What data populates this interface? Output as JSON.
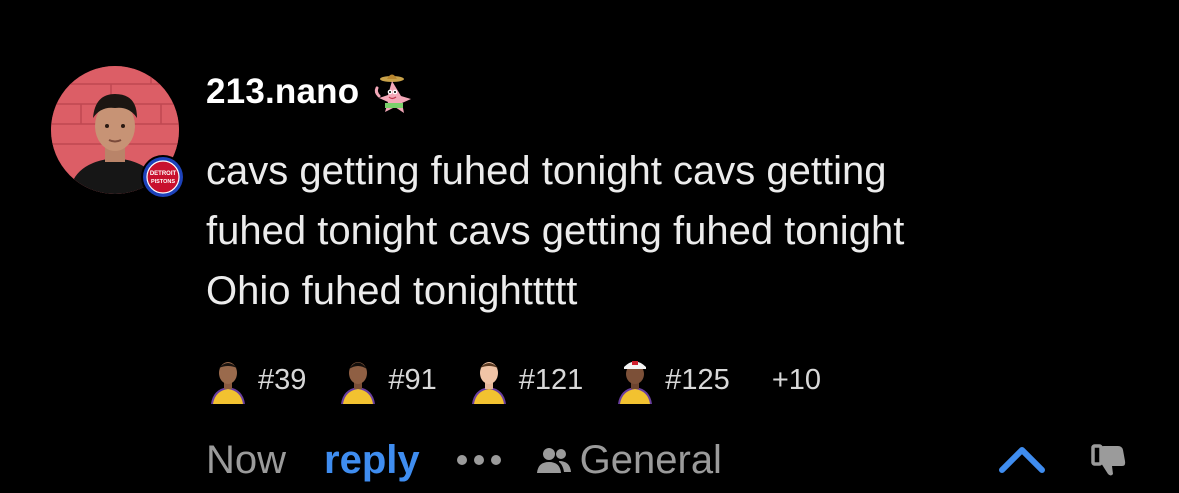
{
  "comment": {
    "username": "213.nano",
    "lines": [
      "cavs getting fuhed tonight cavs getting",
      "fuhed tonight cavs getting fuhed tonight",
      "Ohio fuhed tonighttttt"
    ],
    "avatar_icon": "user-avatar-photo",
    "team_badge": {
      "icon": "detroit-pistons-badge",
      "text_top": "DETROIT",
      "text_bottom": "PISTONS",
      "color": "#c8102e"
    },
    "flair_icon": "patrick-star-sombrero-flair"
  },
  "reactions": {
    "items": [
      {
        "icon": "player-head-icon",
        "rank": "#39"
      },
      {
        "icon": "player-head-icon",
        "rank": "#91"
      },
      {
        "icon": "player-head-icon",
        "rank": "#121"
      },
      {
        "icon": "player-head-icon",
        "rank": "#125"
      }
    ],
    "more": "+10"
  },
  "actions": {
    "time": "Now",
    "reply": "reply",
    "more_icon": "more-dots-icon",
    "channel_icon": "people-icon",
    "channel": "General",
    "upvote_icon": "chevron-up-icon",
    "downvote_icon": "thumbs-down-icon"
  },
  "colors": {
    "background": "#000000",
    "accent": "#3f8df0",
    "text": "#ececec",
    "muted": "#9b9b9b"
  }
}
